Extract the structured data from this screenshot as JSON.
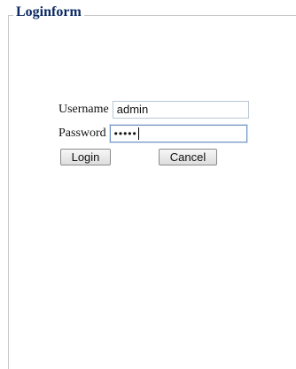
{
  "form": {
    "title": "Loginform",
    "username_label": "Username",
    "username_value": "admin",
    "password_label": "Password",
    "password_mask": "•••••",
    "login_label": "Login",
    "cancel_label": "Cancel"
  }
}
